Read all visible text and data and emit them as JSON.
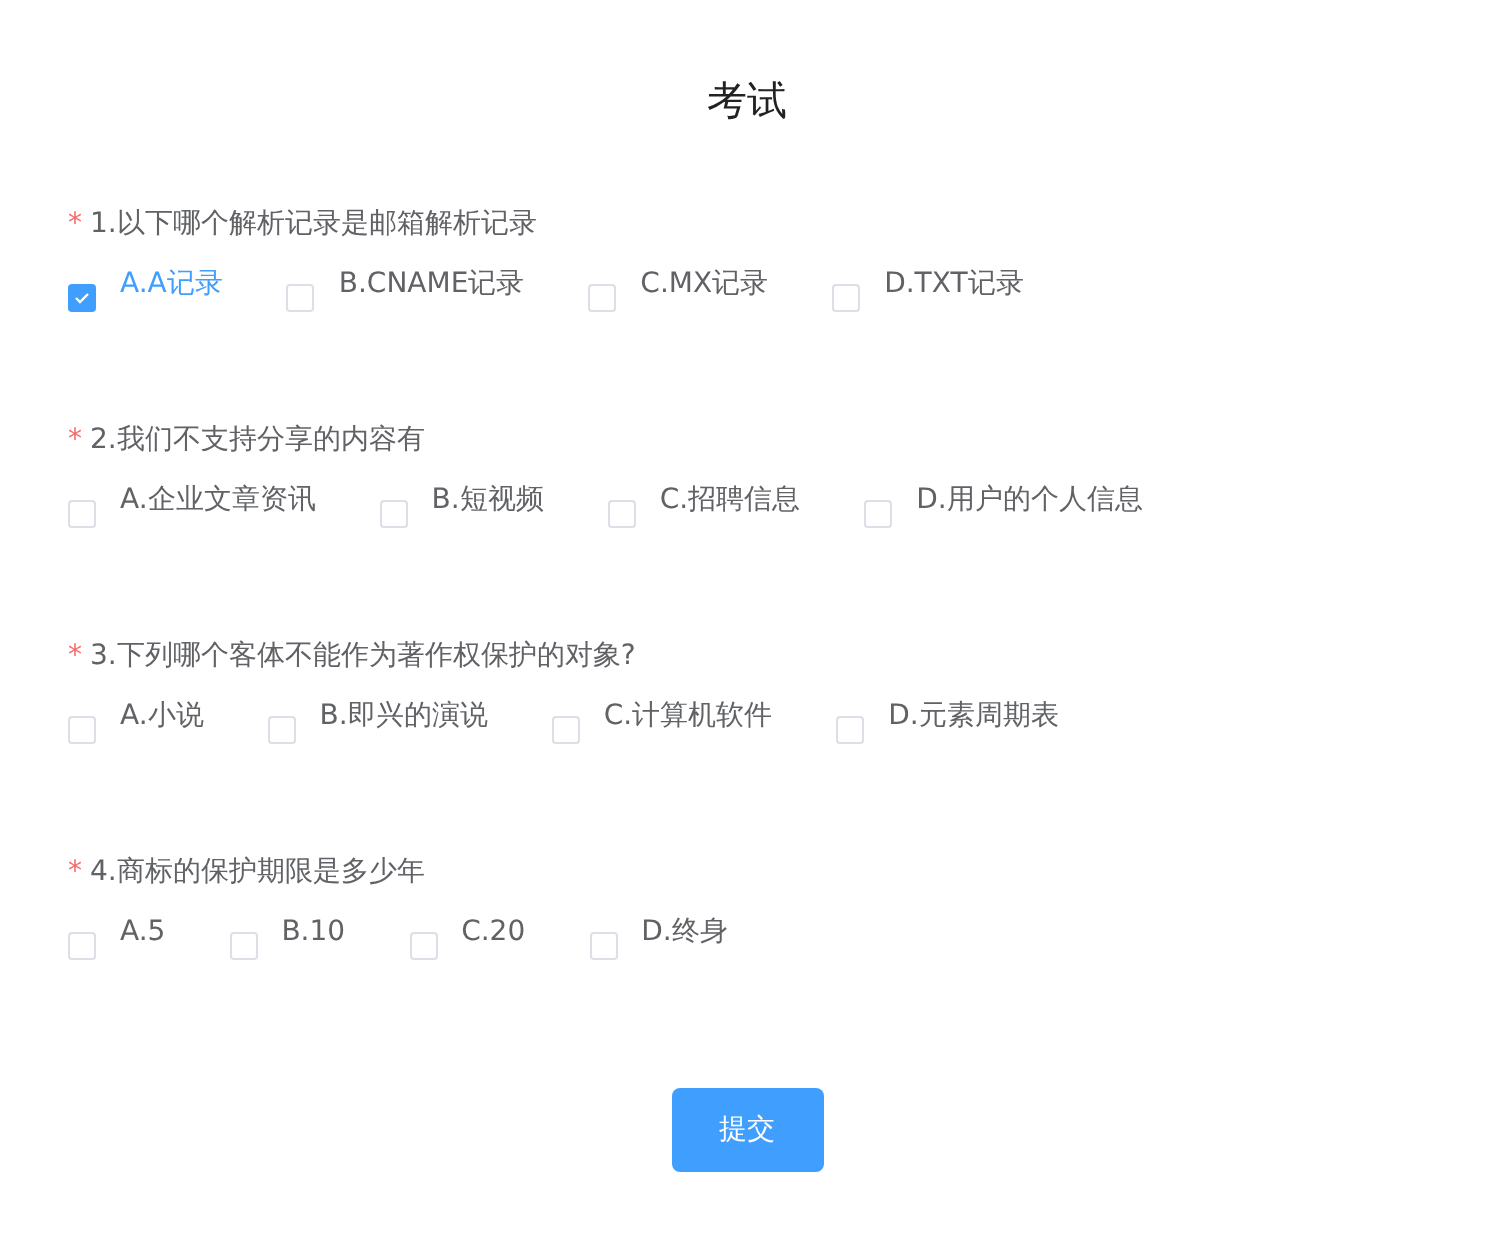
{
  "title": "考试",
  "questions": [
    {
      "mark": "*",
      "text": "1.以下哪个解析记录是邮箱解析记录",
      "options": [
        {
          "label": "A.A记录",
          "checked": true
        },
        {
          "label": "B.CNAME记录",
          "checked": false
        },
        {
          "label": "C.MX记录",
          "checked": false
        },
        {
          "label": "D.TXT记录",
          "checked": false
        }
      ]
    },
    {
      "mark": "*",
      "text": "2.我们不支持分享的内容有",
      "options": [
        {
          "label": "A.企业文章资讯",
          "checked": false
        },
        {
          "label": "B.短视频",
          "checked": false
        },
        {
          "label": "C.招聘信息",
          "checked": false
        },
        {
          "label": "D.用户的个人信息",
          "checked": false
        }
      ]
    },
    {
      "mark": "*",
      "text": "3.下列哪个客体不能作为著作权保护的对象?",
      "options": [
        {
          "label": "A.小说",
          "checked": false
        },
        {
          "label": "B.即兴的演说",
          "checked": false
        },
        {
          "label": "C.计算机软件",
          "checked": false
        },
        {
          "label": "D.元素周期表",
          "checked": false
        }
      ]
    },
    {
      "mark": "*",
      "text": "4.商标的保护期限是多少年",
      "options": [
        {
          "label": "A.5",
          "checked": false
        },
        {
          "label": "B.10",
          "checked": false
        },
        {
          "label": "C.20",
          "checked": false
        },
        {
          "label": "D.终身",
          "checked": false
        }
      ]
    }
  ],
  "submit": "提交"
}
